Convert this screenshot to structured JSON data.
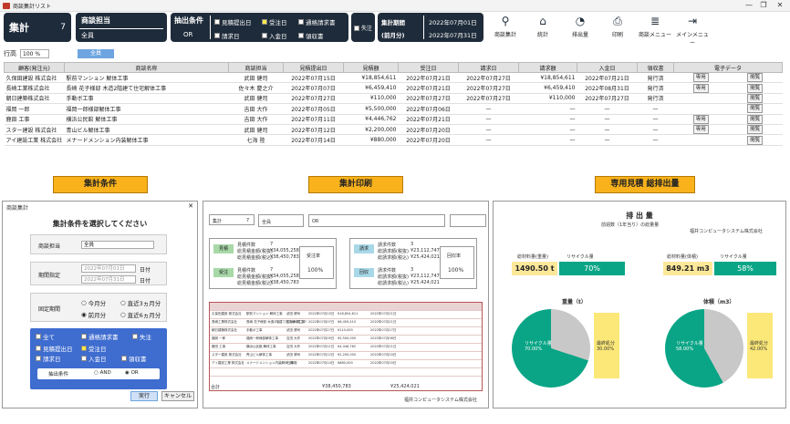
{
  "window": {
    "title": "商談集計リスト",
    "min": "—",
    "max": "❐",
    "close": "✕"
  },
  "header": {
    "sum_label": "集計",
    "sum_count": "7",
    "tanto_label": "商談担当",
    "tanto_value": "全員",
    "cond_label": "抽出条件",
    "cond_logic": "OR",
    "checks": [
      {
        "label": "見積提出日",
        "on": false
      },
      {
        "label": "受注日",
        "on": true
      },
      {
        "label": "通格請求書",
        "on": false
      },
      {
        "label": "請求日",
        "on": false
      },
      {
        "label": "入金日",
        "on": false
      },
      {
        "label": "領収書",
        "on": false
      }
    ],
    "lost_label": "失注",
    "period_label": "集計期間",
    "period_sub": "(前月分)",
    "date_from": "2022年07月01日",
    "date_to": "2022年07月31日"
  },
  "toolbar": [
    {
      "label": "商談集計",
      "icon": "search-icon",
      "glyph": "⚲"
    },
    {
      "label": "統計",
      "icon": "home-icon",
      "glyph": "⌂"
    },
    {
      "label": "排出量",
      "icon": "pie-icon",
      "glyph": "◔"
    },
    {
      "label": "印刷",
      "icon": "printer-icon",
      "glyph": "⎙"
    },
    {
      "label": "商談メニュー",
      "icon": "database-icon",
      "glyph": "≣"
    },
    {
      "label": "メインメニュー",
      "icon": "exit-icon",
      "glyph": "⇥"
    }
  ],
  "rows_label": "行高",
  "rows_value": "100 %",
  "all_button": "全員",
  "table": {
    "columns": [
      "顧客(発注元)",
      "商談名称",
      "商談担当",
      "見積提出日",
      "見積額",
      "受注日",
      "請求日",
      "請求額",
      "入金日",
      "領収書",
      "電子データ"
    ],
    "rows": [
      [
        "久保田建設 株式会社",
        "駅前マンション 解体工事",
        "武田 健司",
        "2022年07月15日",
        "¥18,854,611",
        "2022年07月21日",
        "2022年07月27日",
        "¥18,854,611",
        "2022年07月21日",
        "発行済",
        "専用",
        "閲覧"
      ],
      [
        "長崎工業株式会社",
        "長崎 花子様邸 木造2階建て住宅解体工事",
        "佐々木 慶之介",
        "2022年07月07日",
        "¥6,459,410",
        "2022年07月21日",
        "2022年07月27日",
        "¥6,459,410",
        "2022年08月31日",
        "発行済",
        "専用",
        "閲覧"
      ],
      [
        "朝日建築株式会社",
        "手動ボ工事",
        "武田 健司",
        "2022年07月27日",
        "¥110,000",
        "2022年07月27日",
        "2022年07月27日",
        "¥110,000",
        "2022年07月27日",
        "発行済",
        "",
        "閲覧"
      ],
      [
        "福岡 一郎",
        "福岡一郎様部解体工事",
        "吉田 大作",
        "2022年07月05日",
        "¥5,500,000",
        "2022年07月06日",
        "—",
        "—",
        "—",
        "—",
        "",
        "閲覧"
      ],
      [
        "鹿田 工事",
        "横浜公民館 解体工事",
        "吉田 大作",
        "2022年07月11日",
        "¥4,446,762",
        "2022年07月21日",
        "—",
        "—",
        "—",
        "—",
        "専用",
        "閲覧"
      ],
      [
        "スター建設 株式会社",
        "青山ビル解体工事",
        "武田 健司",
        "2022年07月12日",
        "¥2,200,000",
        "2022年07月20日",
        "—",
        "—",
        "—",
        "—",
        "専用",
        "閲覧"
      ],
      [
        "アイ建設工業 株式会社",
        "メナードメンション内装解体工事",
        "七海 陸",
        "2022年07月14日",
        "¥880,000",
        "2022年07月20日",
        "—",
        "—",
        "—",
        "—",
        "",
        "閲覧"
      ]
    ]
  },
  "sections": [
    "集計条件",
    "集計印刷",
    "専用見積 総排出量"
  ],
  "dialog": {
    "title": "商談集計",
    "close": "✕",
    "heading": "集計条件を選択してください",
    "tanto_label": "商談担当",
    "tanto_value": "全員",
    "period_label": "期間指定",
    "from": "2022年07月01日",
    "to": "2022年07月31日",
    "day": "日付",
    "fixed_label": "固定期間",
    "fixed": [
      "今月分",
      "直近3ヵ月分",
      "前月分",
      "直近6ヵ月分"
    ],
    "checks": [
      "全て",
      "通格請求書",
      "失注",
      "見積提出日",
      "受注日",
      "請求日",
      "入金日",
      "領収書"
    ],
    "extract": "抽出条件",
    "and": "AND",
    "or": "OR",
    "run": "実行",
    "cancel": "キャンセル"
  },
  "print": {
    "sum": "集計",
    "count": "7",
    "order_title": "受注率",
    "order_rate": "100%",
    "collect_title": "回収率",
    "collect_rate": "100%",
    "left_box": [
      [
        "見積件数",
        "7"
      ],
      [
        "総見積金額(税抜)",
        "¥34,055,258"
      ],
      [
        "総見積金額(税込)",
        "¥38,450,783"
      ]
    ],
    "right_box": [
      [
        "請求件数",
        "3"
      ],
      [
        "総請求額(税抜)",
        "¥23,112,747"
      ],
      [
        "総請求額(税込)",
        "¥25,424,021"
      ]
    ],
    "left_labels": [
      "見積",
      "受注"
    ],
    "right_labels": [
      "請求",
      "回収"
    ],
    "total_label": "合計",
    "total1": "¥38,450,783",
    "total2": "¥25,424,021",
    "company": "福井コンピュータシステム株式会社"
  },
  "emission": {
    "title": "排 出 量",
    "sub": "前週数（1年当り）の総量量",
    "company": "福井コンピュータシステム株式会社",
    "left": {
      "qty_label": "総材料量(重量)",
      "qty": "1490.50 t",
      "recycle_label": "リサイクル量",
      "recycle": "70%",
      "chart_title": "重量（t）",
      "pie_label": "リサイクル量\n70.00%",
      "other": "最終処分\n30.00%"
    },
    "right": {
      "qty_label": "総材料量(体積)",
      "qty": "849.21 m3",
      "recycle_label": "リサイクル量",
      "recycle": "58%",
      "chart_title": "体積（m3）",
      "pie_label": "リサイクル量\n58.00%",
      "other": "最終処分\n42.00%"
    },
    "colors": {
      "green": "#0aa586",
      "gray": "#c8c8c8",
      "yellow": "#fbe878"
    }
  }
}
